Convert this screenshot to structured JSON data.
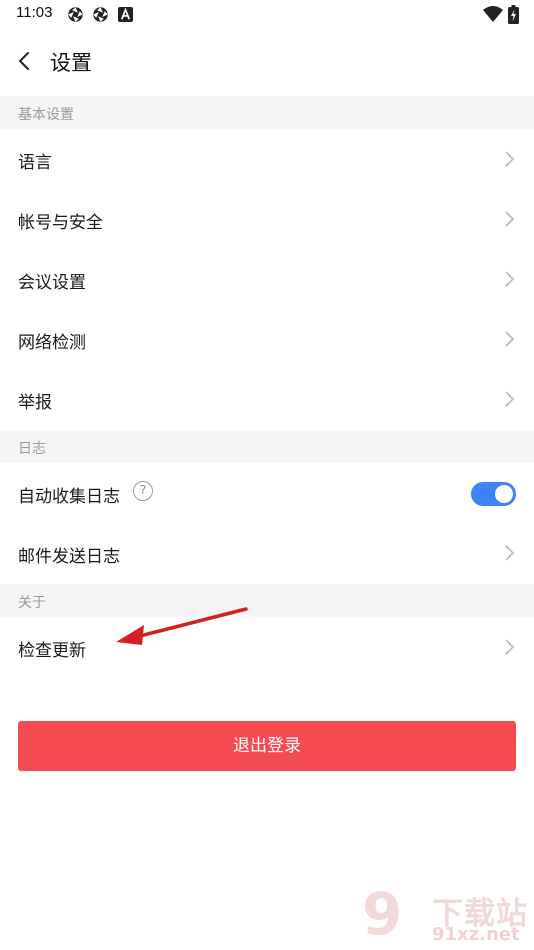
{
  "status_bar": {
    "time": "11:03",
    "left_icons": [
      "aperture-icon",
      "aperture-icon",
      "letter-a-icon"
    ],
    "right_icons": [
      "wifi-icon",
      "battery-charging-icon"
    ]
  },
  "header": {
    "title": "设置",
    "back_icon": "chevron-left-icon"
  },
  "sections": [
    {
      "title": "基本设置",
      "items": [
        {
          "label": "语言"
        },
        {
          "label": "帐号与安全"
        },
        {
          "label": "会议设置"
        },
        {
          "label": "网络检测"
        },
        {
          "label": "举报"
        }
      ]
    },
    {
      "title": "日志",
      "items": [
        {
          "label": "自动收集日志",
          "help_glyph": "?",
          "toggle_on": true
        },
        {
          "label": "邮件发送日志"
        }
      ]
    },
    {
      "title": "关于",
      "items": [
        {
          "label": "检查更新"
        }
      ]
    }
  ],
  "logout_label": "退出登录",
  "annotation": {
    "color": "#d61f1f",
    "points_to": "检查更新"
  },
  "watermark": {
    "mark": "9",
    "text": "下载站",
    "url": "91xz.net"
  },
  "colors": {
    "section_bg": "#f5f5f7",
    "toggle_on": "#3d84f6",
    "logout_button": "#f34b50",
    "chevron": "#b5b5b5"
  }
}
